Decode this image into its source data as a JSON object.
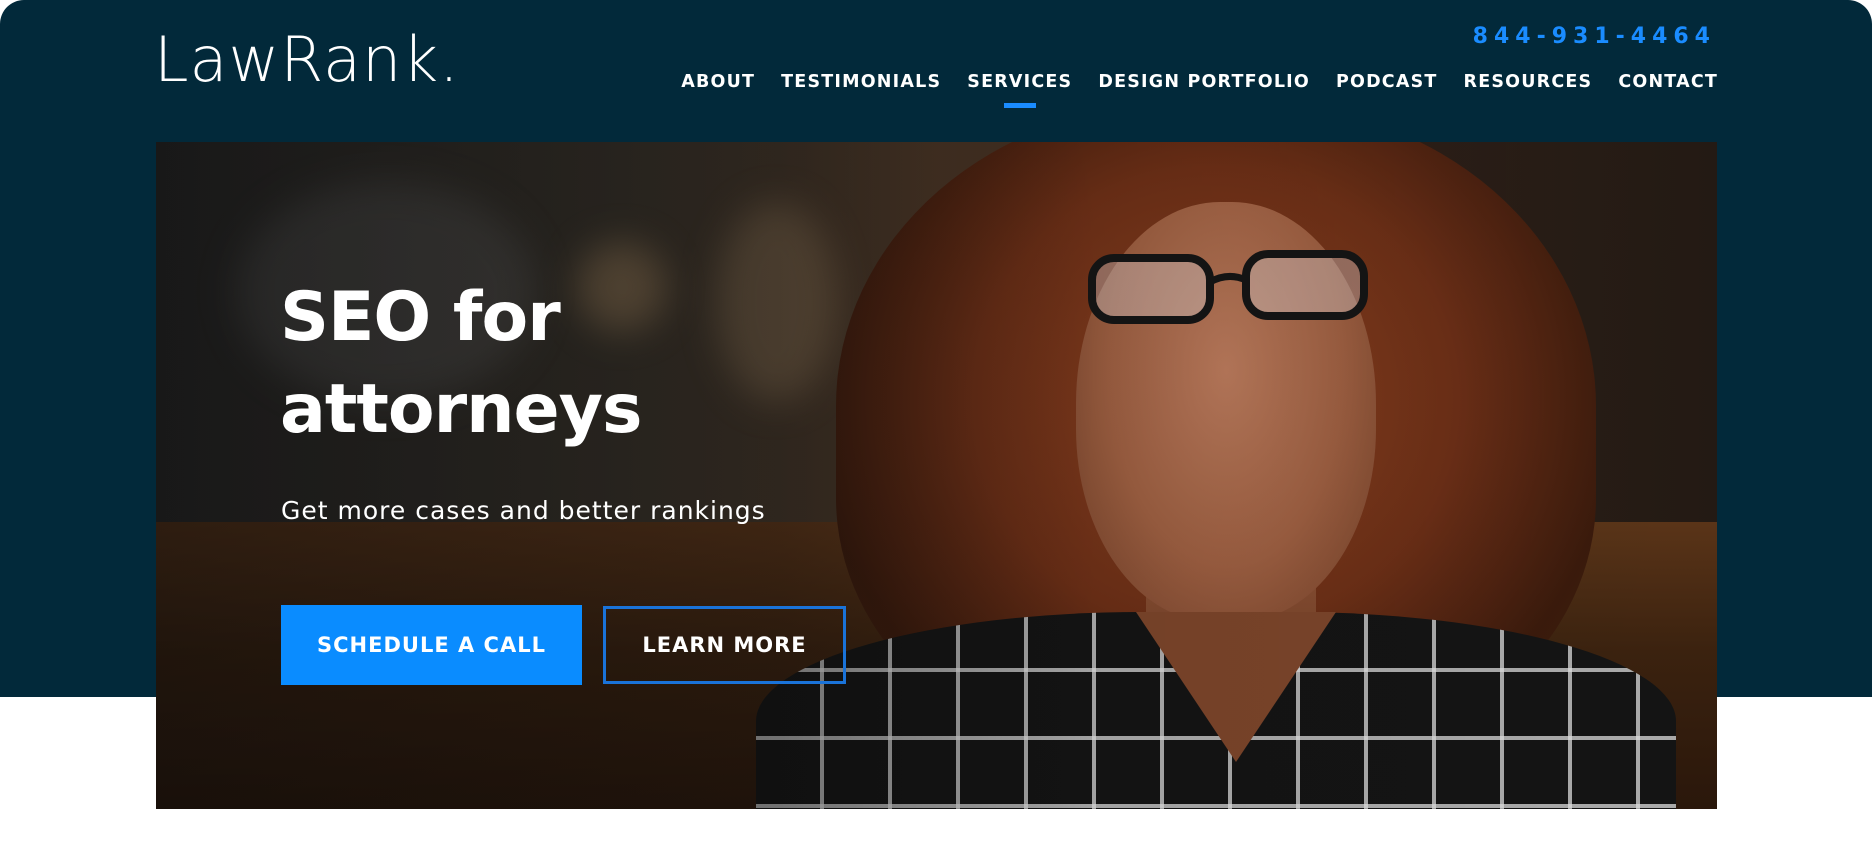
{
  "brand": {
    "logo_text": "LawRank."
  },
  "header": {
    "phone": "844-931-4464"
  },
  "nav": {
    "items": [
      {
        "label": "ABOUT"
      },
      {
        "label": "TESTIMONIALS"
      },
      {
        "label": "SERVICES",
        "active": true
      },
      {
        "label": "DESIGN PORTFOLIO"
      },
      {
        "label": "PODCAST"
      },
      {
        "label": "RESOURCES"
      },
      {
        "label": "CONTACT"
      }
    ]
  },
  "hero": {
    "title_line1": "SEO for",
    "title_line2": "attorneys",
    "subtitle": "Get more cases and better rankings",
    "primary_cta": "SCHEDULE A CALL",
    "secondary_cta": "LEARN MORE"
  },
  "colors": {
    "header_bg": "#02293a",
    "accent": "#0a8cff",
    "text_on_dark": "#ffffff"
  }
}
